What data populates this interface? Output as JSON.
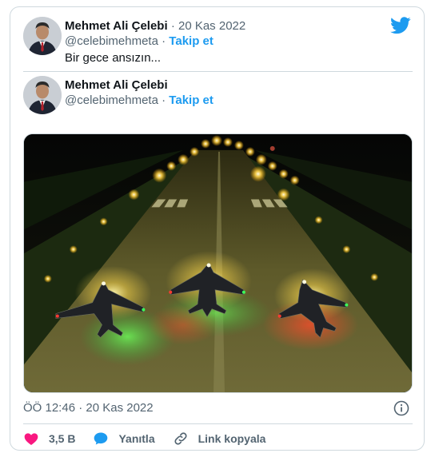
{
  "tweet": {
    "author_name": "Mehmet Ali Çelebi",
    "separator": "·",
    "date": "20 Kas 2022",
    "handle": "@celebimehmeta",
    "follow_label": "Takip et",
    "text": "Bir gece ansızın..."
  },
  "quoted": {
    "author_name": "Mehmet Ali Çelebi",
    "handle": "@celebimehmeta",
    "follow_label": "Takip et"
  },
  "footer": {
    "timestamp": "ÖÖ 12:46 · 20 Kas 2022",
    "likes": "3,5 B",
    "reply_label": "Yanıtla",
    "copy_link_label": "Link kopyala"
  },
  "colors": {
    "brand": "#1d9bf0",
    "like": "#f91880",
    "text_secondary": "#536471"
  },
  "icons": [
    "twitter-bird-icon",
    "heart-icon",
    "reply-bubble-icon",
    "link-icon",
    "info-icon"
  ]
}
